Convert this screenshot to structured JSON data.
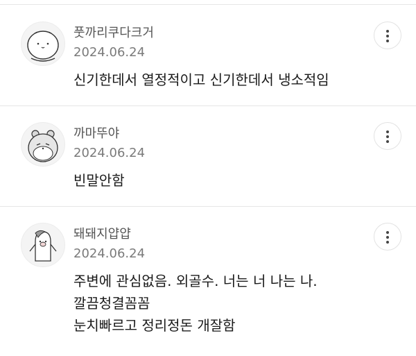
{
  "comments": [
    {
      "nickname": "풋까리쿠다크거",
      "date": "2024.06.24",
      "lines": [
        "신기한데서 열정적이고 신기한데서 냉소적임"
      ],
      "avatar_icon": "round-blob-character-icon",
      "more_icon": "more-vertical-icon"
    },
    {
      "nickname": "까마뚜야",
      "date": "2024.06.24",
      "lines": [
        "빈말안함"
      ],
      "avatar_icon": "hamster-character-icon",
      "more_icon": "more-vertical-icon"
    },
    {
      "nickname": "돼돼지얍얍",
      "date": "2024.06.24",
      "lines": [
        "주변에 관심없음. 외골수. 너는 너 나는 나.",
        "깔끔청결꼼꼼",
        "눈치빠르고 정리정돈 개잘함"
      ],
      "avatar_icon": "pig-penguin-character-icon",
      "more_icon": "more-vertical-icon"
    }
  ],
  "colors": {
    "nickname": "#555555",
    "date": "#7a7a7a",
    "body": "#1a1a1a",
    "divider": "#e6e6e6"
  }
}
